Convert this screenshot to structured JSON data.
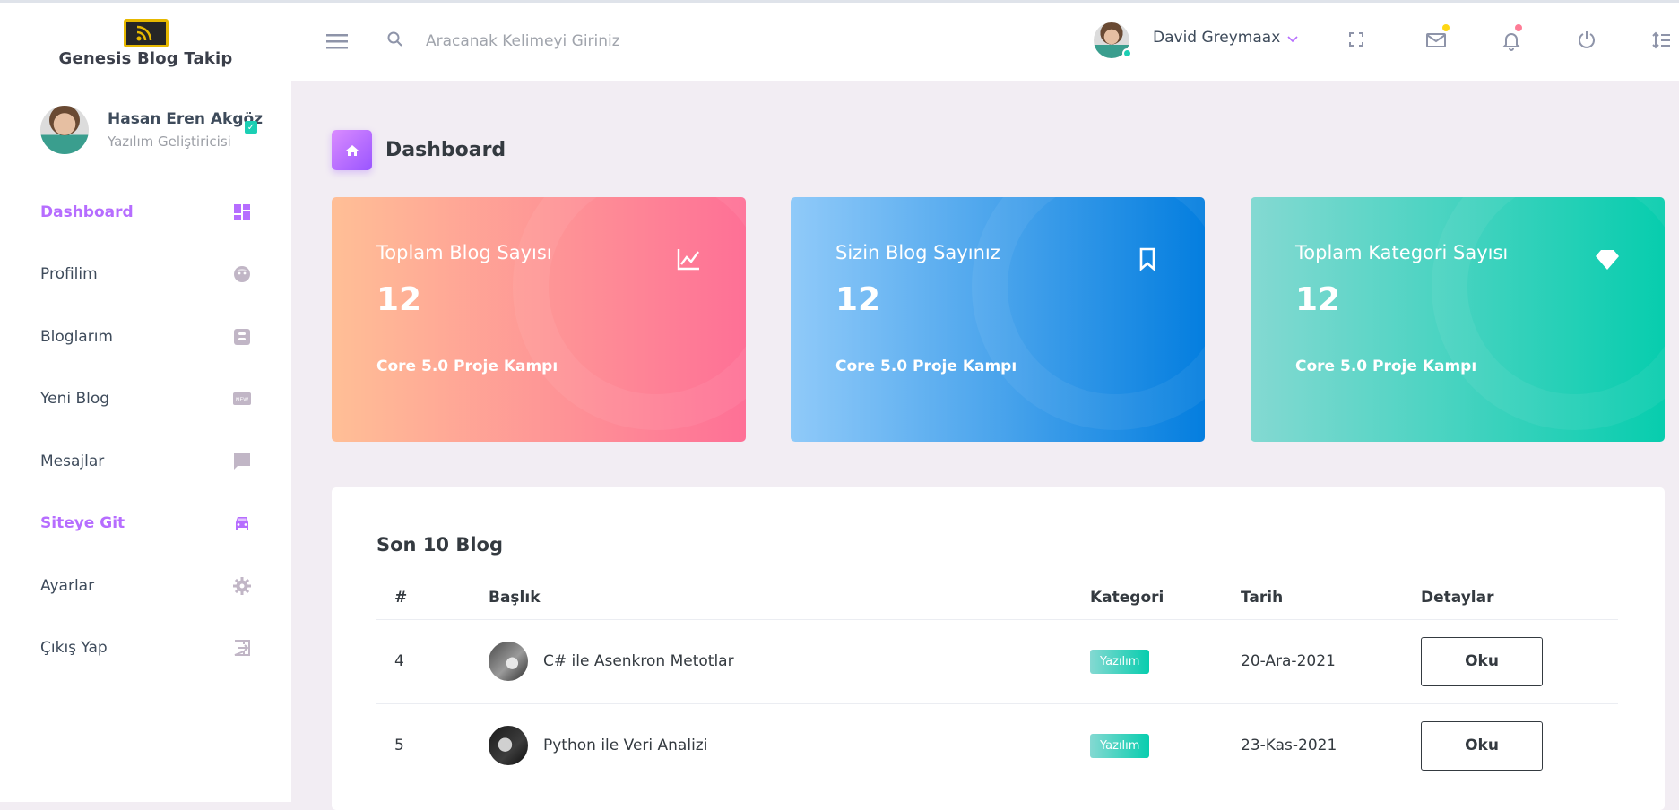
{
  "brand": {
    "name": "Genesis Blog Takip"
  },
  "user_profile": {
    "name": "Hasan Eren Akgöz",
    "role": "Yazılım Geliştiricisi"
  },
  "sidebar": {
    "items": [
      {
        "label": "Dashboard",
        "icon": "dashboard-icon"
      },
      {
        "label": "Profilim",
        "icon": "face-icon"
      },
      {
        "label": "Bloglarım",
        "icon": "blogger-icon"
      },
      {
        "label": "Yeni Blog",
        "icon": "new-box-icon"
      },
      {
        "label": "Mesajlar",
        "icon": "message-icon"
      },
      {
        "label": "Siteye Git",
        "icon": "car-icon"
      },
      {
        "label": "Ayarlar",
        "icon": "gear-icon"
      },
      {
        "label": "Çıkış Yap",
        "icon": "exit-icon"
      }
    ]
  },
  "topbar": {
    "search_placeholder": "Aracanak Kelimeyi Giriniz",
    "user_name": "David Greymaax",
    "mail_dot_color": "#fed713",
    "bell_dot_color": "#fe7c96"
  },
  "page": {
    "title": "Dashboard"
  },
  "cards": [
    {
      "title": "Toplam Blog Sayısı",
      "value": "12",
      "footer": "Core 5.0 Proje Kampı",
      "icon": "chart-line-icon"
    },
    {
      "title": "Sizin Blog Sayınız",
      "value": "12",
      "footer": "Core 5.0 Proje Kampı",
      "icon": "bookmark-icon"
    },
    {
      "title": "Toplam Kategori Sayısı",
      "value": "12",
      "footer": "Core 5.0 Proje Kampı",
      "icon": "diamond-icon"
    }
  ],
  "table": {
    "title": "Son 10 Blog",
    "headers": [
      "#",
      "Başlık",
      "Kategori",
      "Tarih",
      "Detaylar"
    ],
    "rows": [
      {
        "id": "4",
        "title": "C# ile Asenkron Metotlar",
        "category": "Yazılım",
        "date": "20-Ara-2021",
        "action": "Oku"
      },
      {
        "id": "5",
        "title": "Python ile Veri Analizi",
        "category": "Yazılım",
        "date": "23-Kas-2021",
        "action": "Oku"
      }
    ]
  }
}
